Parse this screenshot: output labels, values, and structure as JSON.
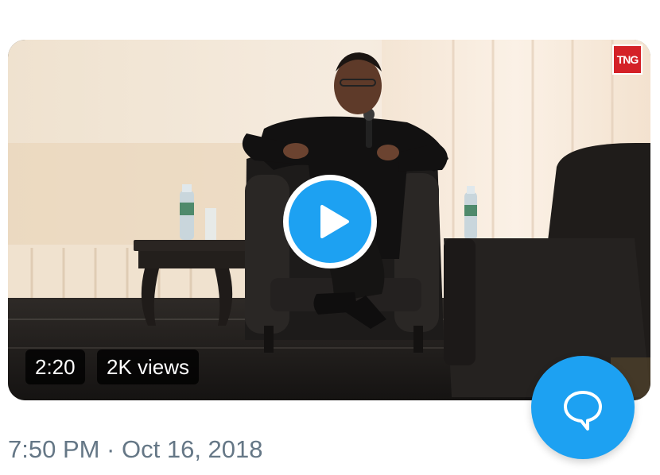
{
  "video": {
    "watermark": "TNG",
    "duration": "2:20",
    "views": "2K views"
  },
  "tweet": {
    "timestamp": "7:50 PM · Oct 16, 2018"
  },
  "icons": {
    "play": "play-icon",
    "compose": "reply-bubble-icon"
  },
  "colors": {
    "accent": "#1da1f2",
    "watermark": "#d42127",
    "timestamp_text": "#657786"
  }
}
